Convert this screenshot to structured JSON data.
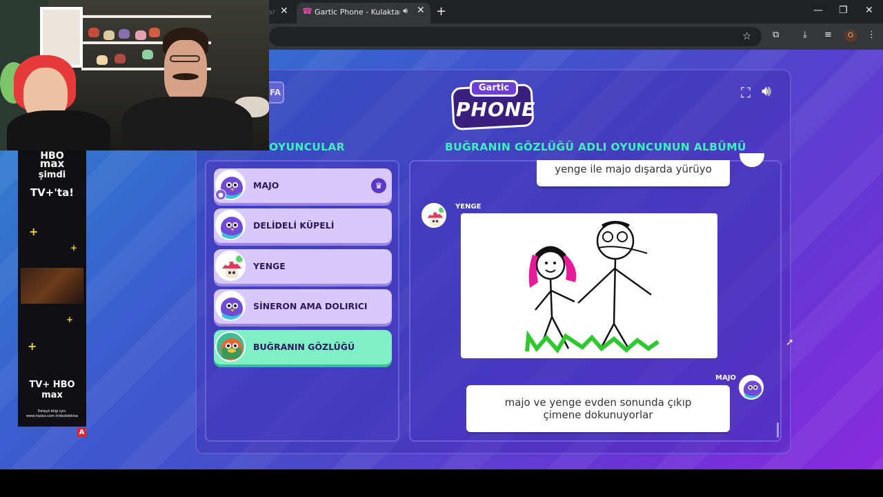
{
  "browser": {
    "active_tab_title": "Gartic Phone - Kulaktan Kul",
    "prev_tab_fragment": "ar",
    "profile_badge": "O",
    "icons": {
      "favicon": "gartic-phone-favicon",
      "tab_audio": "speaker-icon",
      "bookmark": "star-icon"
    }
  },
  "game": {
    "logo_top": "Gartic",
    "logo_main": "PHONE",
    "side_tab_label": "FA",
    "players_header": "OYUNCULAR",
    "album_header": "BUĞRANIN GÖZLÜĞÜ ADLI OYUNCUNUN ALBÜMÜ",
    "players": [
      {
        "name": "MAJO",
        "host": true
      },
      {
        "name": "DELİDELİ KÜPELİ"
      },
      {
        "name": "YENGE"
      },
      {
        "name": "SİNERON AMA DOLIRICI"
      },
      {
        "name": "BUĞRANIN GÖZLÜĞÜ",
        "highlighted": true
      }
    ],
    "album": {
      "top_text": "yenge ile majo dışarda yürüyo",
      "drawing_author": "YENGE",
      "caption_author": "MAJO",
      "caption_text_line1": "majo ve yenge evden sonunda çıkıp",
      "caption_text_line2": "çimene dokunuyorlar"
    }
  },
  "ad": {
    "brand1": "HBO",
    "brand2": "max",
    "line": "şimdi",
    "tv": "TV+'ta!",
    "footer": "TV+ HBO max",
    "small1": "Detaylı bilgi için:",
    "small2": "www.tvplus.com.tr/destekkisa",
    "flag": "A"
  },
  "colors": {
    "accent_green": "#3ef0c0",
    "player_card": "#d8c8fb",
    "player_highlight": "#7ff0c6",
    "panel_purple": "#4a49c9"
  }
}
